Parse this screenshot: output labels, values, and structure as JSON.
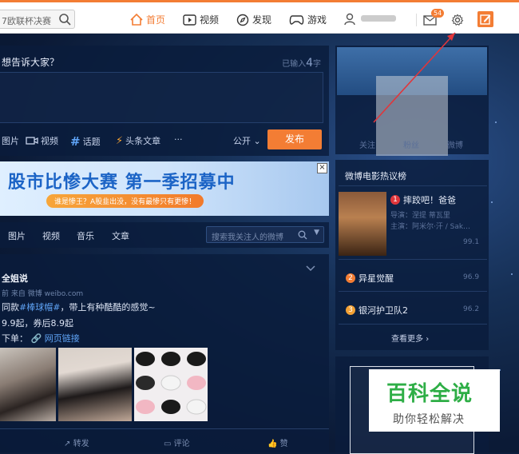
{
  "topnav": {
    "search_value": "7欧联杯决赛",
    "home": "首页",
    "video": "视频",
    "discover": "发现",
    "games": "游戏",
    "mail_badge": "54"
  },
  "compose": {
    "title": "想告诉大家？",
    "counter_label": "已输入",
    "counter_value": "4",
    "counter_unit": "字",
    "tools": [
      "图片",
      "视频",
      "话题",
      "头条文章",
      "···"
    ],
    "visibility": "公开",
    "publish": "发布"
  },
  "banner": {
    "headline": "股市比惨大赛 第一季招募中",
    "sub": "谁是惨王？A股韭出没，没有最惨只有更惨！",
    "close": "×"
  },
  "filter_tabs": {
    "items": [
      "图片",
      "视频",
      "音乐",
      "文章"
    ],
    "search_placeholder": "搜索我关注人的微博"
  },
  "post": {
    "author": "全姐说",
    "meta": "前 来自 微博 weibo.com",
    "line1_pre": "同款",
    "line1_tag": "#棒球帽#",
    "line1_post": "，带上有种酷酷的感觉~",
    "line2": "9.9起，券后8.9起",
    "line3_pre": "下单：",
    "line3_link": "网页链接",
    "actions": [
      "转发",
      "评论",
      "赞"
    ]
  },
  "profile": {
    "stats": [
      "关注",
      "粉丝",
      "微博"
    ]
  },
  "movie_rank": {
    "title": "微博电影热议榜",
    "items": [
      {
        "rank": "1",
        "name": "摔跤吧！爸爸",
        "score": "99.1",
        "director": "导演：涅提 蒂瓦里",
        "actors": "主演：阿米尔·汗 / Sak…",
        "color": "#e0363b"
      },
      {
        "rank": "2",
        "name": "异星觉醒",
        "score": "96.9",
        "color": "#f37d34"
      },
      {
        "rank": "3",
        "name": "银河护卫队2",
        "score": "96.2",
        "color": "#f3a134"
      }
    ],
    "more": "查看更多"
  },
  "watermark": {
    "title": "百科全说",
    "subtitle": "助你轻松解决"
  }
}
